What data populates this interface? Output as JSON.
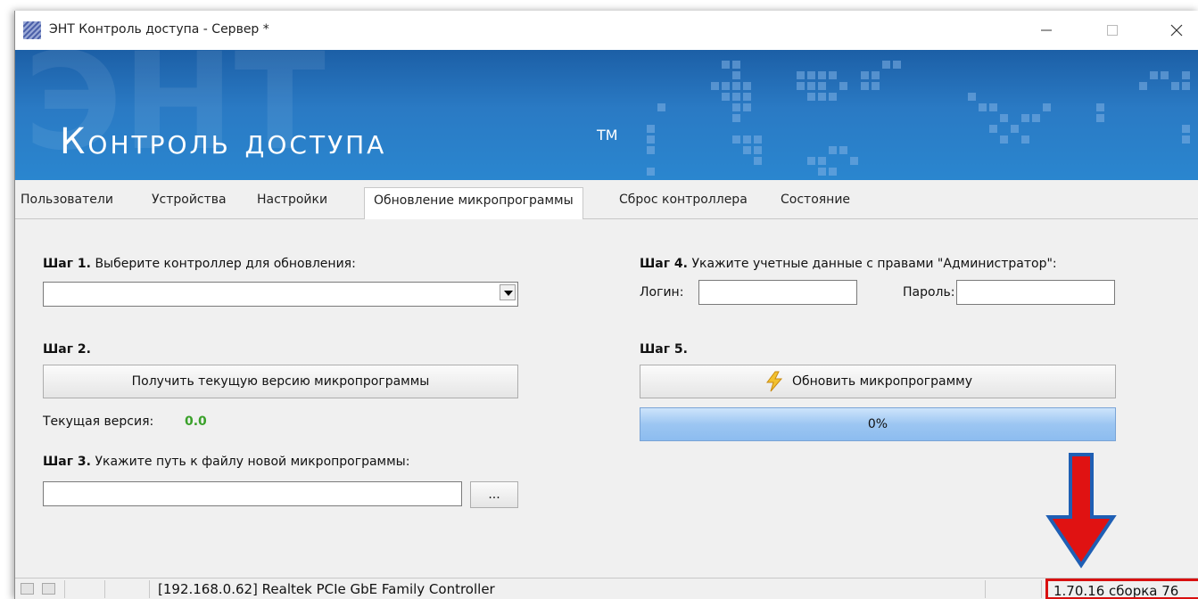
{
  "window": {
    "title": "ЭНТ Контроль доступа - Сервер *"
  },
  "banner": {
    "title": "Контроль доступа",
    "tm": "TM"
  },
  "tabs": [
    {
      "label": "Пользователи"
    },
    {
      "label": "Устройства"
    },
    {
      "label": "Настройки"
    },
    {
      "label": "Обновление микропрограммы"
    },
    {
      "label": "Сброс контроллера"
    },
    {
      "label": "Состояние"
    }
  ],
  "active_tab": "Обновление микропрограммы",
  "step1": {
    "bold": "Шаг 1.",
    "text": " Выберите контроллер для обновления:",
    "combo_value": ""
  },
  "step2": {
    "bold": "Шаг 2.",
    "button": "Получить текущую версию микропрограммы",
    "current_label": "Текущая версия:",
    "current_value": "0.0"
  },
  "step3": {
    "bold": "Шаг 3.",
    "text": " Укажите путь к файлу новой микропрограммы:",
    "path_value": "",
    "browse_button": "..."
  },
  "step4": {
    "bold": "Шаг 4.",
    "text": " Укажите учетные данные с правами \"Администратор\":",
    "login_label": "Логин:",
    "login_value": "",
    "password_label": "Пароль:",
    "password_value": ""
  },
  "step5": {
    "bold": "Шаг 5.",
    "button": "Обновить микропрограмму",
    "progress_text": "0%",
    "progress": 0
  },
  "statusbar": {
    "connection": "[192.168.0.62] Realtek PCIe GbE Family Controller",
    "version": "1.70.16 сборка 76"
  },
  "colors": {
    "version_value": "#3aa12a",
    "highlight_frame": "#d91010",
    "banner": "#2a7ac4"
  }
}
